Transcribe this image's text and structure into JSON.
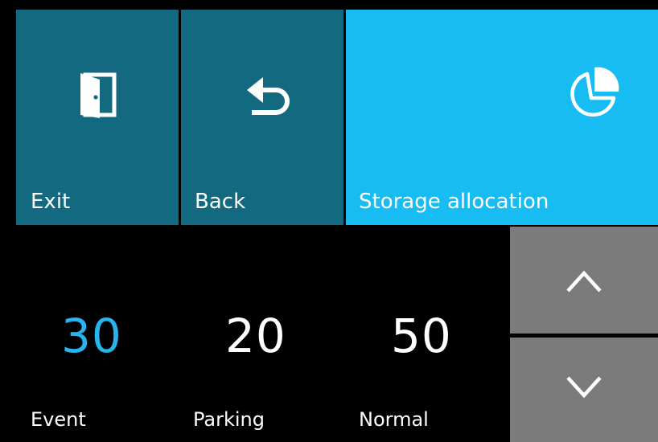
{
  "tiles": {
    "exit": {
      "label": "Exit",
      "icon": "door-exit-icon"
    },
    "back": {
      "label": "Back",
      "icon": "back-arrow-icon"
    },
    "storage": {
      "label": "Storage allocation",
      "icon": "pie-chart-icon"
    }
  },
  "allocation": {
    "event": {
      "value": "30",
      "label": "Event",
      "selected": true
    },
    "parking": {
      "value": "20",
      "label": "Parking"
    },
    "normal": {
      "value": "50",
      "label": "Normal"
    }
  },
  "controls": {
    "up_icon": "chevron-up-icon",
    "down_icon": "chevron-down-icon"
  },
  "colors": {
    "dark_tile": "#136a80",
    "accent_tile": "#17bdf2",
    "selected_value": "#25b6ee",
    "stepper": "#7b7b7b",
    "background": "#000000"
  }
}
